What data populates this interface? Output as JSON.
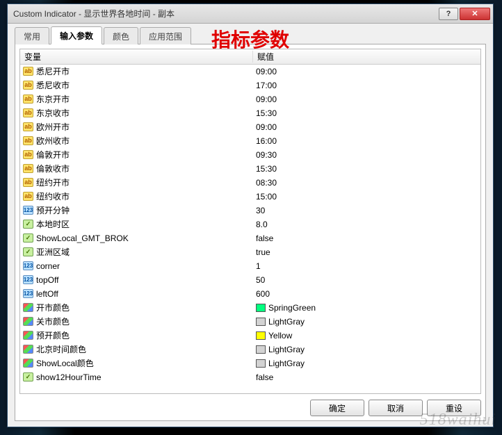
{
  "window": {
    "title": "Custom Indicator - 显示世界各地时间 - 副本"
  },
  "titlebar_buttons": {
    "help": "?",
    "close": "✕"
  },
  "overlay_label": "指标参数",
  "tabs": [
    {
      "label": "常用"
    },
    {
      "label": "输入参数"
    },
    {
      "label": "颜色"
    },
    {
      "label": "应用范围"
    }
  ],
  "active_tab": 1,
  "columns": {
    "name": "变量",
    "value": "赋值"
  },
  "params": [
    {
      "icon": "ab",
      "name": "悉尼开市",
      "value": "09:00"
    },
    {
      "icon": "ab",
      "name": "悉尼收市",
      "value": "17:00"
    },
    {
      "icon": "ab",
      "name": "东京开市",
      "value": "09:00"
    },
    {
      "icon": "ab",
      "name": "东京收市",
      "value": "15:30"
    },
    {
      "icon": "ab",
      "name": "欧州开市",
      "value": "09:00"
    },
    {
      "icon": "ab",
      "name": "欧州收市",
      "value": "16:00"
    },
    {
      "icon": "ab",
      "name": "倫敦开市",
      "value": "09:30"
    },
    {
      "icon": "ab",
      "name": "倫敦收市",
      "value": "15:30"
    },
    {
      "icon": "ab",
      "name": "纽约开市",
      "value": "08:30"
    },
    {
      "icon": "ab",
      "name": "纽约收市",
      "value": "15:00"
    },
    {
      "icon": "123",
      "name": "预开分钟",
      "value": "30"
    },
    {
      "icon": "vx",
      "name": "本地时区",
      "value": "8.0"
    },
    {
      "icon": "vx",
      "name": "ShowLocal_GMT_BROK",
      "value": "false"
    },
    {
      "icon": "vx",
      "name": "亚洲区域",
      "value": "true"
    },
    {
      "icon": "123",
      "name": "corner",
      "value": "1"
    },
    {
      "icon": "123",
      "name": "topOff",
      "value": "50"
    },
    {
      "icon": "123",
      "name": "leftOff",
      "value": "600"
    },
    {
      "icon": "color",
      "name": "开市颜色",
      "value": "SpringGreen",
      "swatch": "#00ff7f"
    },
    {
      "icon": "color",
      "name": "关市颜色",
      "value": "LightGray",
      "swatch": "#d3d3d3"
    },
    {
      "icon": "color",
      "name": "预开颜色",
      "value": "Yellow",
      "swatch": "#ffff00"
    },
    {
      "icon": "color",
      "name": "北京时间颜色",
      "value": "LightGray",
      "swatch": "#d3d3d3"
    },
    {
      "icon": "color",
      "name": "ShowLocal颜色",
      "value": "LightGray",
      "swatch": "#d3d3d3"
    },
    {
      "icon": "vx",
      "name": "show12HourTime",
      "value": "false"
    }
  ],
  "buttons": {
    "ok": "确定",
    "cancel": "取消",
    "reset": "重设"
  },
  "watermark": "518waihui"
}
